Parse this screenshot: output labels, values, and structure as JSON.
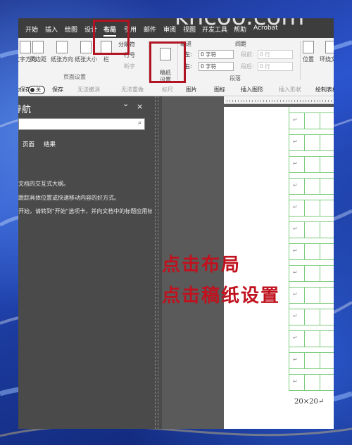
{
  "watermark": "khcoo.com",
  "tabs": [
    "开始",
    "插入",
    "绘图",
    "设计",
    "布局",
    "引用",
    "邮件",
    "审阅",
    "视图",
    "开发工具",
    "帮助",
    "Acrobat"
  ],
  "ribbon": {
    "margins": "文字方向",
    "page_margins": "页边距",
    "orientation": "纸张方向",
    "size": "纸张大小",
    "columns": "栏",
    "breaks": "分隔符",
    "line_numbers": "行号",
    "hyphenation": "断字",
    "page_setup_group": "页面设置",
    "grid_paper_button": "稿纸\n设置",
    "grid_paper_group": "稿纸",
    "indent_label": "缩进",
    "spacing_label": "间距",
    "left_label": "左:",
    "right_label": "右:",
    "left_value": "0 字符",
    "right_value": "0 字符",
    "before_label": "段前:",
    "after_label": "段后:",
    "before_value": "0 行",
    "after_value": "0 行",
    "paragraph_group": "段落",
    "position": "位置",
    "wrap": "环绕文字"
  },
  "quick_access": {
    "autosave": "自动保存",
    "toggle_state": "关",
    "save": "保存",
    "undo": "无法撤消",
    "redo": "无法重做",
    "ruler": "标尺",
    "picture": "图片",
    "icons": "图标",
    "insert_shape": "插入图形",
    "insert_shapes": "插入形状",
    "draw_table": "绘制表格"
  },
  "nav": {
    "title": "导航",
    "close_glyph": "×",
    "chevron_glyph": "⌄",
    "search_glyph": "⌕",
    "tabs": [
      "页面",
      "结果"
    ],
    "lines": [
      "文档的交互式大纲。",
      "跟踪具体位置或快速移动内容的好方式。",
      "开始，请转到\"开始\"选项卡，并向文档中的标题应用标题"
    ]
  },
  "document": {
    "return_mark": "↵",
    "footer": "20×20↵"
  },
  "annotations": {
    "line1": "点击布局",
    "line2": "点击稿纸设置"
  },
  "colors": {
    "annotation_red": "#c0121e",
    "grid_green": "#7ccb7c",
    "tabbar": "#3d3d3d"
  }
}
